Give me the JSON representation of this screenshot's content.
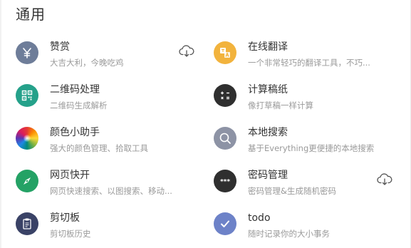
{
  "section": {
    "title": "通用"
  },
  "plugins": [
    {
      "name": "赞赏",
      "desc": "大吉大利，今晚吃鸡",
      "icon": "yen-icon",
      "color": "#6e7d99",
      "download": true
    },
    {
      "name": "在线翻译",
      "desc": "一个非常轻巧的翻译工具，不巧...",
      "icon": "translate-icon",
      "color": "#f2b33d",
      "download": false
    },
    {
      "name": "二维码处理",
      "desc": "二维码生成解析",
      "icon": "qrcode-icon",
      "color": "#25a18a",
      "download": false
    },
    {
      "name": "计算稿纸",
      "desc": "像打草稿一样计算",
      "icon": "calculator-icon",
      "color": "#2f2f2f",
      "download": false
    },
    {
      "name": "颜色小助手",
      "desc": "强大的颜色管理、拾取工具",
      "icon": "color-wheel-icon",
      "color": "#ffffff",
      "download": false
    },
    {
      "name": "本地搜索",
      "desc": "基于Everything更便捷的本地搜索",
      "icon": "search-icon",
      "color": "#8d93a5",
      "download": false
    },
    {
      "name": "网页快开",
      "desc": "网页快速搜索、以图搜索、移动...",
      "icon": "compass-icon",
      "color": "#24a265",
      "download": false
    },
    {
      "name": "密码管理",
      "desc": "密码管理&生成随机密码",
      "icon": "password-icon",
      "color": "#2f2f2f",
      "download": true
    },
    {
      "name": "剪切板",
      "desc": "剪切板历史",
      "icon": "clipboard-icon",
      "color": "#3a4266",
      "download": false
    },
    {
      "name": "todo",
      "desc": "随时记录你的大小事务",
      "icon": "check-icon",
      "color": "#6d82c8",
      "download": false
    }
  ],
  "download_icon": "cloud-download-icon"
}
